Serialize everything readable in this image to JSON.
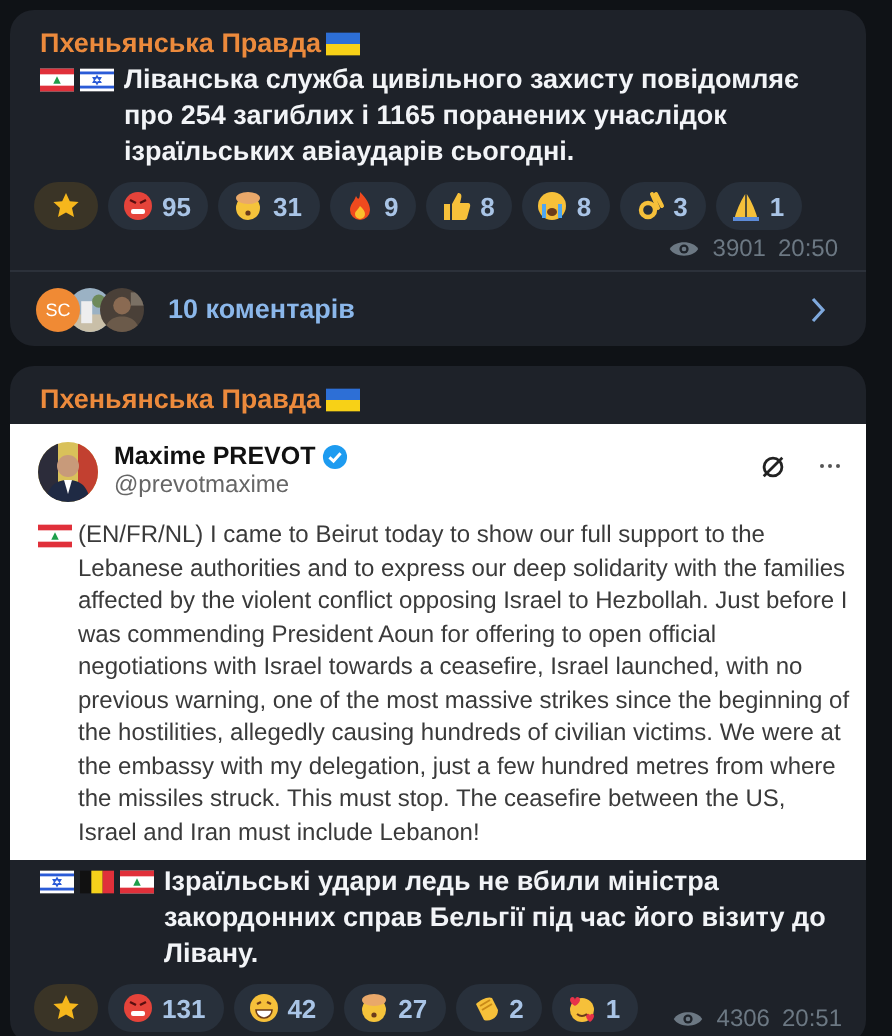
{
  "posts": [
    {
      "channel": "Пхеньянська Правда",
      "channel_flag": {
        "kind": "ukraine"
      },
      "text_flags": [
        {
          "kind": "lebanon"
        },
        {
          "kind": "israel"
        }
      ],
      "text": "Ліванська служба цивільного захисту повідомляє про 254 загиблих і 1165 поранених унаслідок ізраїльських авіаударів сьогодні.",
      "reactions": [
        {
          "kind": "star"
        },
        {
          "kind": "angry",
          "count": "95"
        },
        {
          "kind": "exploding",
          "count": "31"
        },
        {
          "kind": "fire",
          "count": "9"
        },
        {
          "kind": "thumbs",
          "count": "8"
        },
        {
          "kind": "crying",
          "count": "8"
        },
        {
          "kind": "ok",
          "count": "3"
        },
        {
          "kind": "pray",
          "count": "1"
        }
      ],
      "views": "3901",
      "time": "20:50",
      "comments": {
        "avatar_initials": "SC",
        "label": "10 коментарів"
      }
    },
    {
      "channel": "Пхеньянська Правда",
      "channel_flag": {
        "kind": "ukraine"
      },
      "embed": {
        "author": "Maxime PREVOT",
        "handle": "@prevotmaxime",
        "text_flag": {
          "kind": "lebanon"
        },
        "text": "(EN/FR/NL) I came to Beirut today to show our full support to the Lebanese authorities and to express our deep solidarity with the families affected by the violent conflict opposing Israel to Hezbollah. Just before I was commending President Aoun for offering to open official negotiations with Israel towards a ceasefire, Israel launched, with no previous warning, one of the most massive strikes since the beginning of the hostilities, allegedly causing hundreds of civilian victims. We were at the embassy with my delegation, just a few hundred metres from where the missiles struck. This must stop. The ceasefire between the US, Israel and Iran must include Lebanon!"
      },
      "text_flags": [
        {
          "kind": "israel"
        },
        {
          "kind": "belgium"
        },
        {
          "kind": "lebanon"
        }
      ],
      "text": "Ізраїльські удари ледь не вбили міністра закордонних справ Бельгії під час його візиту до Лівану.",
      "reactions": [
        {
          "kind": "star"
        },
        {
          "kind": "angry",
          "count": "131"
        },
        {
          "kind": "grin",
          "count": "42"
        },
        {
          "kind": "exploding",
          "count": "27"
        },
        {
          "kind": "clap",
          "count": "2"
        },
        {
          "kind": "hearts",
          "count": "1"
        }
      ],
      "views": "4306",
      "time": "20:51"
    }
  ]
}
